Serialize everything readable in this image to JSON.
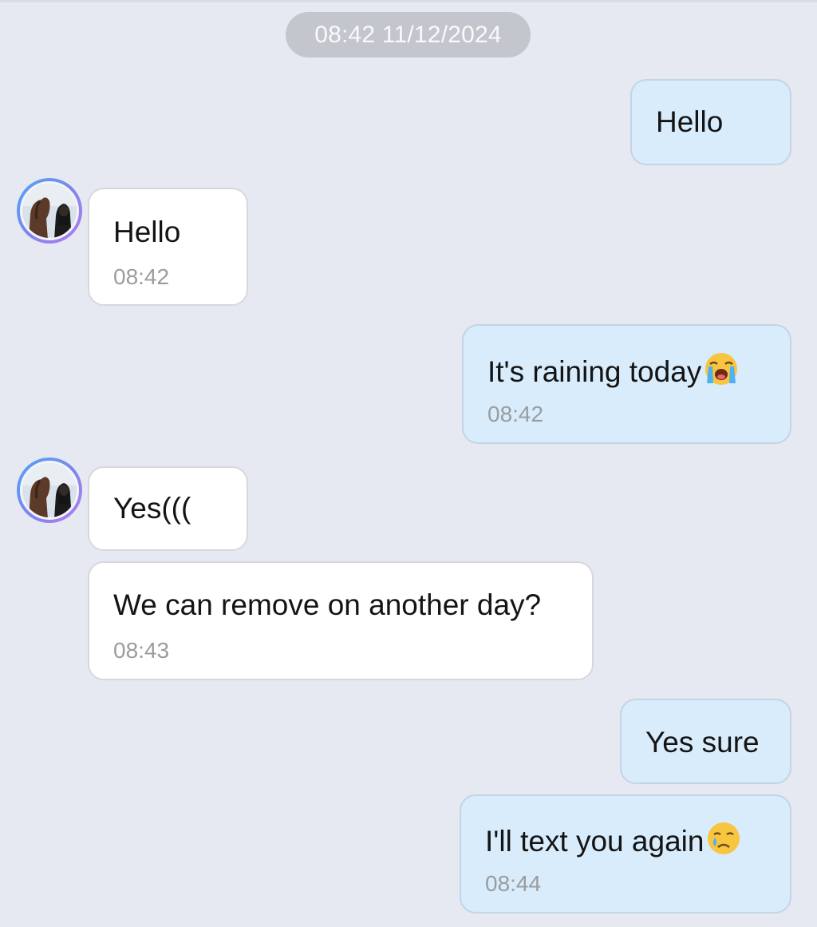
{
  "chat": {
    "date_separator": "08:42 11/12/2024",
    "messages": [
      {
        "id": "m1",
        "direction": "outgoing",
        "text": "Hello",
        "time": ""
      },
      {
        "id": "m2",
        "direction": "incoming",
        "text": "Hello",
        "time": "08:42"
      },
      {
        "id": "m3",
        "direction": "outgoing",
        "text": "It's raining today",
        "emoji": "loudly-crying-face",
        "time": "08:42"
      },
      {
        "id": "m4",
        "direction": "incoming",
        "text": "Yes(((",
        "time": ""
      },
      {
        "id": "m5",
        "direction": "incoming",
        "text": "We can remove on another day?",
        "time": "08:43"
      },
      {
        "id": "m6",
        "direction": "outgoing",
        "text": "Yes sure",
        "time": ""
      },
      {
        "id": "m7",
        "direction": "outgoing",
        "text": "I'll text you again",
        "emoji": "crying-face",
        "time": "08:44"
      }
    ]
  },
  "colors": {
    "background": "#e6e9f2",
    "outgoing_bubble": "#d8ecfb",
    "incoming_bubble": "#ffffff",
    "timestamp": "#9a9c9f",
    "date_pill": "#c3c6cc"
  },
  "icons": {
    "avatar": "contact-avatar-photo",
    "emoji_raining": "loudly-crying-face-emoji",
    "emoji_again": "crying-face-emoji"
  }
}
